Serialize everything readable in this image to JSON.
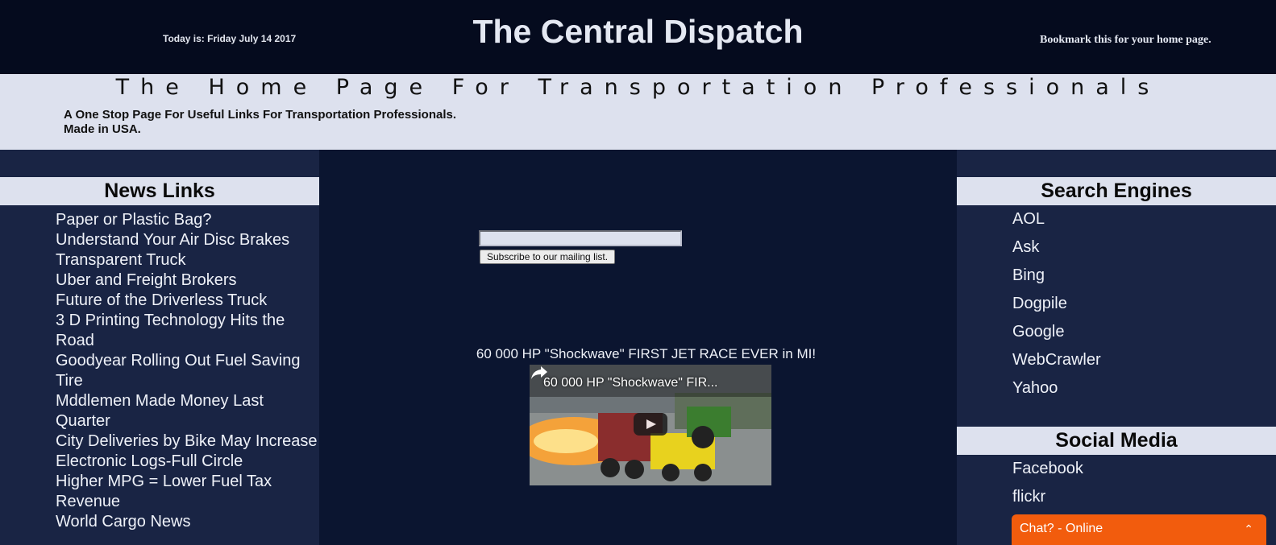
{
  "header": {
    "date": "Today is: Friday July 14 2017",
    "title": "The Central Dispatch",
    "bookmark": "Bookmark this for your home page."
  },
  "banner": {
    "tagline": "The Home Page For Transportation Professionals",
    "description_line1": "A One Stop Page For Useful Links For Transportation Professionals.",
    "description_line2": "Made in USA."
  },
  "news": {
    "heading": "News Links",
    "items": [
      "Paper or Plastic Bag?",
      "Understand Your Air Disc Brakes",
      "Transparent Truck",
      "Uber and Freight Brokers",
      "Future of the Driverless Truck",
      "3 D Printing Technology Hits the Road",
      "Goodyear Rolling Out Fuel Saving Tire",
      "Mddlemen Made Money Last Quarter",
      "City Deliveries by Bike May Increase",
      "Electronic Logs-Full Circle",
      "Higher MPG = Lower Fuel Tax Revenue",
      "World Cargo News"
    ]
  },
  "mailing": {
    "input_value": "",
    "button_label": "Subscribe to our mailing list."
  },
  "video": {
    "caption": "60 000 HP \"Shockwave\" FIRST JET RACE EVER in MI!",
    "overlay_title": "60 000 HP \"Shockwave\" FIR..."
  },
  "search": {
    "heading": "Search Engines",
    "items": [
      "AOL",
      "Ask",
      "Bing",
      "Dogpile",
      "Google",
      "WebCrawler",
      "Yahoo"
    ]
  },
  "social": {
    "heading": "Social Media",
    "items": [
      "Facebook",
      "flickr"
    ]
  },
  "chat": {
    "label": "Chat? - Online",
    "chevron": "⌃"
  },
  "colors": {
    "background": "#0c1630",
    "sidebar": "#192444",
    "header": "#050b1e",
    "band": "#dde1ee",
    "chat": "#f25c0d"
  },
  "icons": [
    "share-icon",
    "play-icon",
    "chevron-up-icon"
  ]
}
